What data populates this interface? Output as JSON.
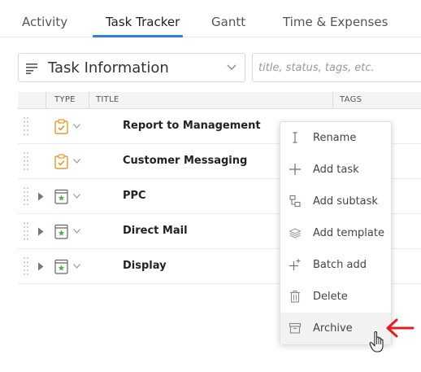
{
  "tabs": [
    {
      "label": "Activity",
      "active": false
    },
    {
      "label": "Task Tracker",
      "active": true
    },
    {
      "label": "Gantt",
      "active": false
    },
    {
      "label": "Time & Expenses",
      "active": false
    }
  ],
  "view_selector": {
    "label": "Task Information"
  },
  "search": {
    "placeholder": "title, status, tags, etc.",
    "value": ""
  },
  "table": {
    "columns": [
      "TYPE",
      "TITLE",
      "TAGS"
    ],
    "rows": [
      {
        "title": "Report to Management",
        "type_icon": "task-icon",
        "expandable": false
      },
      {
        "title": "Customer Messaging",
        "type_icon": "task-icon",
        "expandable": false
      },
      {
        "title": "PPC",
        "type_icon": "project-icon",
        "expandable": true
      },
      {
        "title": "Direct Mail",
        "type_icon": "project-icon",
        "expandable": true
      },
      {
        "title": "Display",
        "type_icon": "project-icon",
        "expandable": true
      }
    ]
  },
  "context_menu": {
    "items": [
      {
        "label": "Rename",
        "icon": "text-cursor-icon"
      },
      {
        "label": "Add task",
        "icon": "plus-icon"
      },
      {
        "label": "Add subtask",
        "icon": "subtask-icon"
      },
      {
        "label": "Add template",
        "icon": "template-icon"
      },
      {
        "label": "Batch add",
        "icon": "batch-add-icon"
      },
      {
        "label": "Delete",
        "icon": "trash-icon"
      },
      {
        "label": "Archive",
        "icon": "archive-icon",
        "hovered": true
      }
    ]
  },
  "colors": {
    "accent": "#2f7ed8",
    "task_icon": "#e39b2b",
    "project_icon": "#4caf50",
    "annotation_arrow": "#e02020"
  }
}
